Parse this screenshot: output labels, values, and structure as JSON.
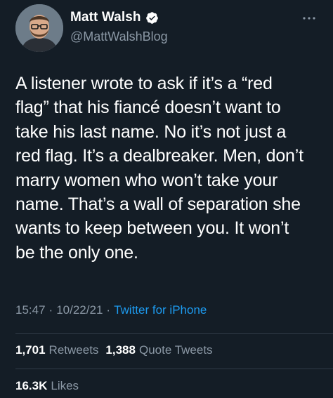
{
  "author": {
    "display_name": "Matt Walsh",
    "handle": "@MattWalshBlog"
  },
  "tweet": {
    "text": "A listener wrote to ask if it’s a “red\nflag” that his fiancé doesn’t want to\ntake his last name. No it’s not just a\nred flag. It’s a dealbreaker. Men, don’t\nmarry women who won’t take your\nname. That’s a wall of separation she\nwants to keep between you. It won’t\nbe the only one.",
    "time": "15:47",
    "date": "10/22/21",
    "separator": "·",
    "source": "Twitter for iPhone"
  },
  "stats": {
    "retweets_count": "1,701",
    "retweets_label": "Retweets",
    "quotes_count": "1,388",
    "quotes_label": "Quote Tweets",
    "likes_count": "16.3K",
    "likes_label": "Likes"
  },
  "icons": {
    "verified": "verified-badge-icon",
    "more": "more-options-icon"
  },
  "colors": {
    "background": "#141d26",
    "secondary_text": "#8b98a5",
    "link": "#1d9bf0",
    "divider": "#2f3b47"
  }
}
